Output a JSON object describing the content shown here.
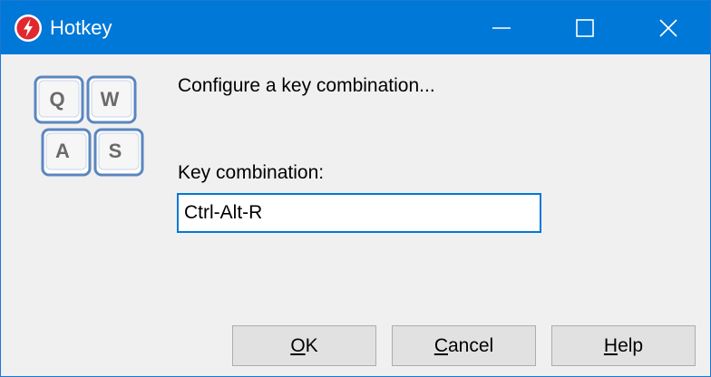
{
  "window": {
    "title": "Hotkey",
    "app_icon": "lightning-icon",
    "accent_color": "#0078d7"
  },
  "caption_buttons": {
    "minimize_icon": "minimize-icon",
    "maximize_icon": "maximize-icon",
    "close_icon": "close-icon"
  },
  "dialog": {
    "icon": "keyboard-keys-icon",
    "icon_keys": [
      "Q",
      "W",
      "A",
      "S"
    ],
    "prompt": "Configure a key combination...",
    "field_label": "Key combination:",
    "field_value": "Ctrl-Alt-R"
  },
  "buttons": {
    "ok": {
      "mnemonic": "O",
      "rest": "K"
    },
    "cancel": {
      "mnemonic": "C",
      "rest": "ancel"
    },
    "help": {
      "mnemonic": "H",
      "rest": "elp"
    }
  }
}
